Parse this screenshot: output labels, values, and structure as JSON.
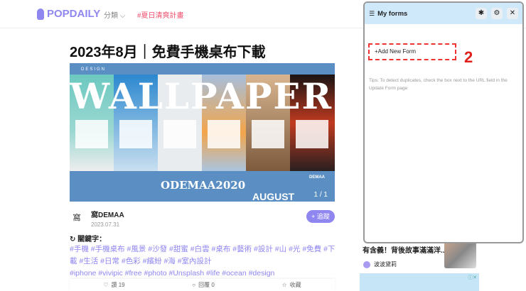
{
  "header": {
    "logo": "POPDAILY",
    "category": "分類",
    "promo": "#夏日清爽計畫"
  },
  "article": {
    "title": "2023年8月｜免費手機桌布下載",
    "hero": {
      "top_label": "DESIGN",
      "big_text": "WALLPAPERS",
      "brand": "ODEMAA2020",
      "month": "AUGUST",
      "pager": "1 / 1",
      "logo_text": "DEMAA"
    },
    "author": {
      "name": "窩DEMAA",
      "date": "2023.07.31",
      "avatar_text": "窩"
    },
    "follow_label": "+ 追蹤",
    "keywords_label": "關鍵字：",
    "tags_line1": "#手機 #手機桌布 #風景 #沙發 #甜蜜 #白雲 #桌布 #藝術 #設計 #山 #光 #免費 #下載 #生活 #日常 #色彩 #繽紛 #海 #室內設計",
    "tags_line2": "#iphone #vivipic #free #photo #Unsplash #life #ocean #design",
    "actions": {
      "like": "讚 19",
      "comment": "回覆 0",
      "save": "收藏"
    }
  },
  "sidebar": {
    "article_title": "有含義！背後故事滿滿洋...",
    "author": "波波黛莉"
  },
  "panel": {
    "title": "My forms",
    "add_label": "+Add New Form",
    "step": "2",
    "tips": "Tips: To detect duplicates, check the box next to the URL field in the Update Form page"
  }
}
